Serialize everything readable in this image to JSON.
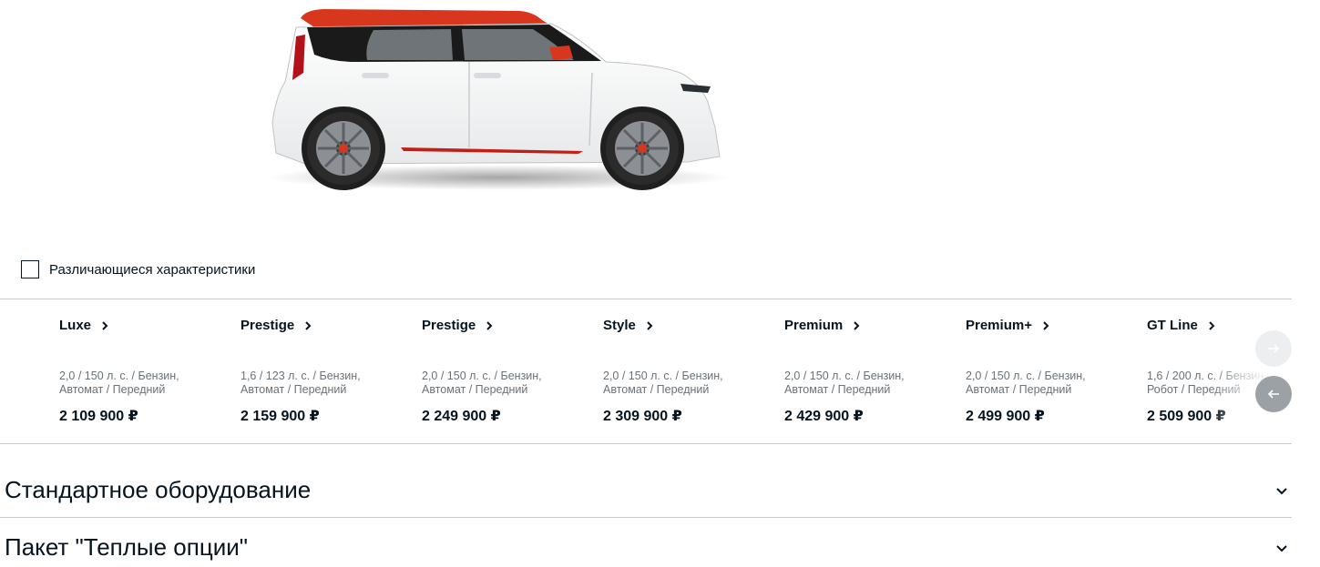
{
  "car_image": {
    "name": "kia-soul-white-red-roof"
  },
  "filter": {
    "label": "Различающиеся характеристики",
    "checked": false
  },
  "trims": [
    {
      "name": "Luxe",
      "spec_line1": "2,0 / 150 л. с. / Бензин,",
      "spec_line2": "Автомат / Передний",
      "price": "2 109 900 ₽"
    },
    {
      "name": "Prestige",
      "spec_line1": "1,6 / 123 л. с. / Бензин,",
      "spec_line2": "Автомат / Передний",
      "price": "2 159 900 ₽"
    },
    {
      "name": "Prestige",
      "spec_line1": "2,0 / 150 л. с. / Бензин,",
      "spec_line2": "Автомат / Передний",
      "price": "2 249 900 ₽"
    },
    {
      "name": "Style",
      "spec_line1": "2,0 / 150 л. с. / Бензин,",
      "spec_line2": "Автомат / Передний",
      "price": "2 309 900 ₽"
    },
    {
      "name": "Premium",
      "spec_line1": "2,0 / 150 л. с. / Бензин,",
      "spec_line2": "Автомат / Передний",
      "price": "2 429 900 ₽"
    },
    {
      "name": "Premium+",
      "spec_line1": "2,0 / 150 л. с. / Бензин,",
      "spec_line2": "Автомат / Передний",
      "price": "2 499 900 ₽"
    },
    {
      "name": "GT Line",
      "spec_line1": "1,6 / 200 л. с. / Бензин,",
      "spec_line2": "Робот / Передний",
      "price": "2 509 900 ₽"
    }
  ],
  "nav": {
    "next_icon": "arrow-right-icon",
    "prev_icon": "arrow-left-icon"
  },
  "sections": [
    {
      "title": "Стандартное оборудование",
      "icon": "chevron-down-icon"
    },
    {
      "title": "Пакет \"Теплые опции\"",
      "icon": "chevron-down-icon"
    }
  ],
  "colors": {
    "text": "#05141f",
    "muted": "#697279",
    "divider": "#c9cacc",
    "accent_red": "#d8371d"
  }
}
